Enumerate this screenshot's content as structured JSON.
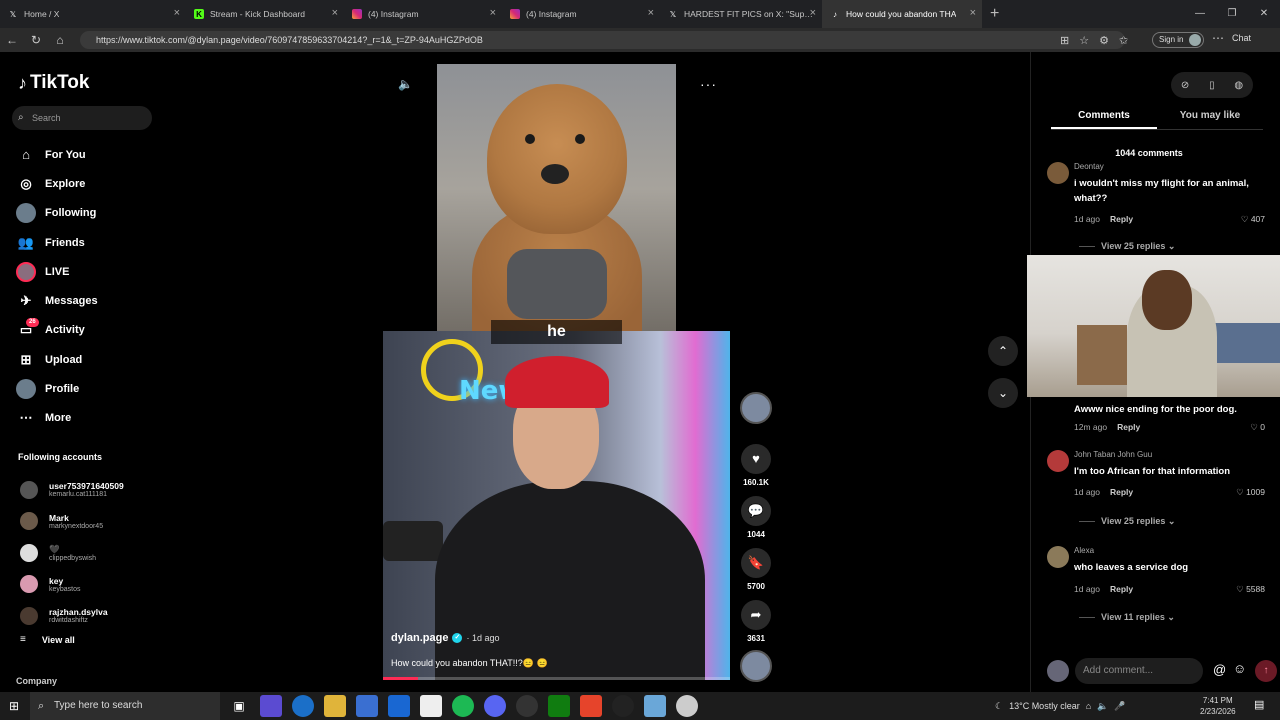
{
  "browser": {
    "tabs": [
      {
        "title": "Home / X",
        "icon": "x-logo-icon",
        "active": false
      },
      {
        "title": "Stream - Kick Dashboard",
        "icon": "kick-logo-icon",
        "active": false
      },
      {
        "title": "(4) Instagram",
        "icon": "instagram-logo-icon",
        "active": false
      },
      {
        "title": "(4) Instagram",
        "icon": "instagram-logo-icon",
        "active": false
      },
      {
        "title": "HARDEST FIT PICS on X: \"Supreme",
        "icon": "x-logo-icon",
        "active": false
      },
      {
        "title": "How could you abandon THA",
        "icon": "tiktok-logo-icon",
        "active": true
      }
    ],
    "url": "https://www.tiktok.com/@dylan.page/video/7609747859633704214?_r=1&_t=ZP-94AuHGZPdOB",
    "signin_label": "Sign in",
    "chat_label": "Chat"
  },
  "sidebar": {
    "brand": "TikTok",
    "search_placeholder": "Search",
    "nav": [
      {
        "label": "For You",
        "icon": "home-icon"
      },
      {
        "label": "Explore",
        "icon": "compass-icon"
      },
      {
        "label": "Following",
        "icon": "following-avatar-icon"
      },
      {
        "label": "Friends",
        "icon": "friends-icon"
      },
      {
        "label": "LIVE",
        "icon": "live-icon"
      },
      {
        "label": "Messages",
        "icon": "messages-icon"
      },
      {
        "label": "Activity",
        "icon": "activity-icon",
        "badge": "26"
      },
      {
        "label": "Upload",
        "icon": "upload-icon"
      },
      {
        "label": "Profile",
        "icon": "profile-avatar-icon"
      },
      {
        "label": "More",
        "icon": "more-dots-icon"
      }
    ],
    "following_heading": "Following accounts",
    "following": [
      {
        "name": "user7539716405​09",
        "handle": "kemarlu.cat111181"
      },
      {
        "name": "Mark",
        "handle": "markynextdoor45"
      },
      {
        "name": "🖤",
        "handle": "clippedbyswish"
      },
      {
        "name": "key",
        "handle": "keybastos"
      },
      {
        "name": "rajzhan.dsylva",
        "handle": "rdwitdashiftz"
      }
    ],
    "view_all": "View all",
    "company": "Company"
  },
  "video": {
    "caption_overlay": "he",
    "author": "dylan.page",
    "posted": "· 1d ago",
    "description": "How could you abandon THAT!!?😑 😑",
    "progress": 0.1
  },
  "actions": {
    "likes": "160.1K",
    "comments": "1044",
    "saves": "5700",
    "shares": "3631"
  },
  "comments_panel": {
    "tabs": [
      "Comments",
      "You may like"
    ],
    "count_label": "1044 comments",
    "comments": [
      {
        "user": "Deontay",
        "text": "i wouldn't miss my flight for an animal, what??",
        "time": "1d ago",
        "likes": "407",
        "replies": "View 25 replies"
      },
      {
        "user": "",
        "text": "Awww nice ending for the poor dog.",
        "time": "12m ago",
        "likes": "0",
        "replies": ""
      },
      {
        "user": "John Taban John Guu",
        "text": "I'm too African for that information",
        "time": "1d ago",
        "likes": "1009",
        "replies": "View 25 replies"
      },
      {
        "user": "Alexa",
        "text": "who leaves a service dog",
        "time": "1d ago",
        "likes": "5588",
        "replies": "View 11 replies"
      }
    ],
    "reply_label": "Reply",
    "add_comment_placeholder": "Add comment..."
  },
  "taskbar": {
    "search_placeholder": "Type here to search",
    "weather": "13°C  Mostly clear",
    "time": "7:41 PM",
    "date": "2/23/2026"
  }
}
